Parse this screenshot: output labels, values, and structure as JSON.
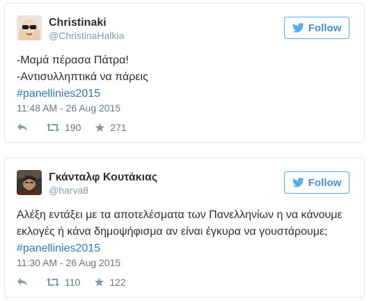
{
  "colors": {
    "link": "#2b7bb9",
    "follow_border": "#55acee",
    "muted": "#8899a6"
  },
  "tweets": [
    {
      "name": "Christinaki",
      "handle": "@ChristinaHalkia",
      "follow_label": "Follow",
      "lines": [
        "-Μαμά πέρασα Πάτρα!",
        "-Αντισυλληπτικά να πάρεις"
      ],
      "hashtag": "#panellinies2015",
      "timestamp": "11:48 AM - 26 Aug 2015",
      "retweets": "190",
      "likes": "271",
      "icons": [
        "reply-icon",
        "retweet-icon",
        "star-icon"
      ]
    },
    {
      "name": "Γκάνταλφ Κουτάκιας",
      "handle": "@harva8",
      "follow_label": "Follow",
      "lines": [
        "Αλέξη εντάξει με τα αποτελέσματα των Πανελληνίων η να κάνουμε",
        "εκλογές ή κάνα δημοψήφισμα αν είναι έγκυρα να γουστάρουμε;"
      ],
      "hashtag": "#panellinies2015",
      "timestamp": "11:30 AM - 26 Aug 2015",
      "retweets": "110",
      "likes": "122",
      "icons": [
        "reply-icon",
        "retweet-icon",
        "star-icon"
      ]
    }
  ]
}
